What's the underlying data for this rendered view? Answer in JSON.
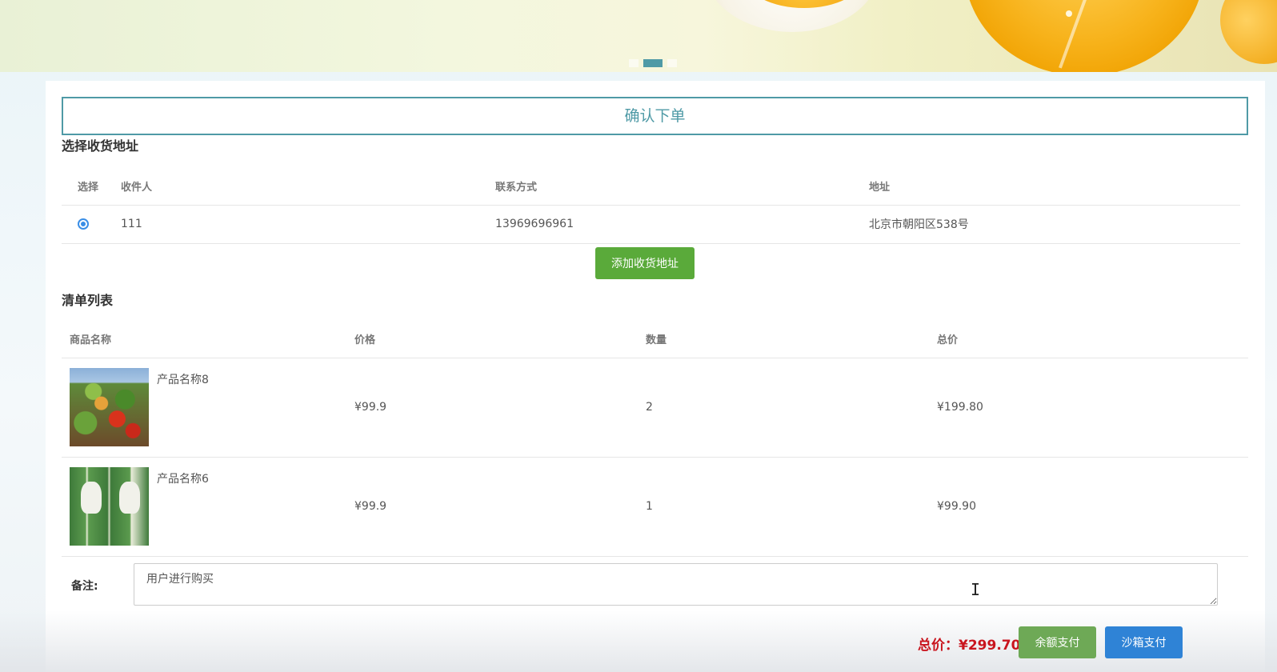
{
  "banner": {
    "carousel_dots": 3,
    "active_dot": 2
  },
  "page": {
    "title": "确认下单"
  },
  "address": {
    "section_title": "选择收货地址",
    "headers": {
      "select": "选择",
      "name": "收件人",
      "phone": "联系方式",
      "address": "地址"
    },
    "rows": [
      {
        "selected": true,
        "name": "111",
        "phone": "13969696961",
        "address": "北京市朝阳区538号"
      }
    ],
    "add_button": "添加收货地址"
  },
  "goods": {
    "section_title": "清单列表",
    "headers": {
      "name": "商品名称",
      "price": "价格",
      "qty": "数量",
      "total": "总价"
    },
    "rows": [
      {
        "image": "vegetables-image",
        "name": "产品名称8",
        "price": "¥99.9",
        "qty": "2",
        "total": "¥199.80"
      },
      {
        "image": "feed-bag-image",
        "name": "产品名称6",
        "price": "¥99.9",
        "qty": "1",
        "total": "¥99.90"
      }
    ]
  },
  "remark": {
    "label": "备注:",
    "value": "用户进行购买"
  },
  "footer": {
    "total_label": "总价：¥299.70",
    "pay_balance": "余额支付",
    "pay_sandbox": "沙箱支付"
  },
  "colors": {
    "accent": "#4f9aa6",
    "green_button": "#5aaa3a",
    "blue_button": "#2f83d6",
    "total_red": "#c9151e"
  }
}
